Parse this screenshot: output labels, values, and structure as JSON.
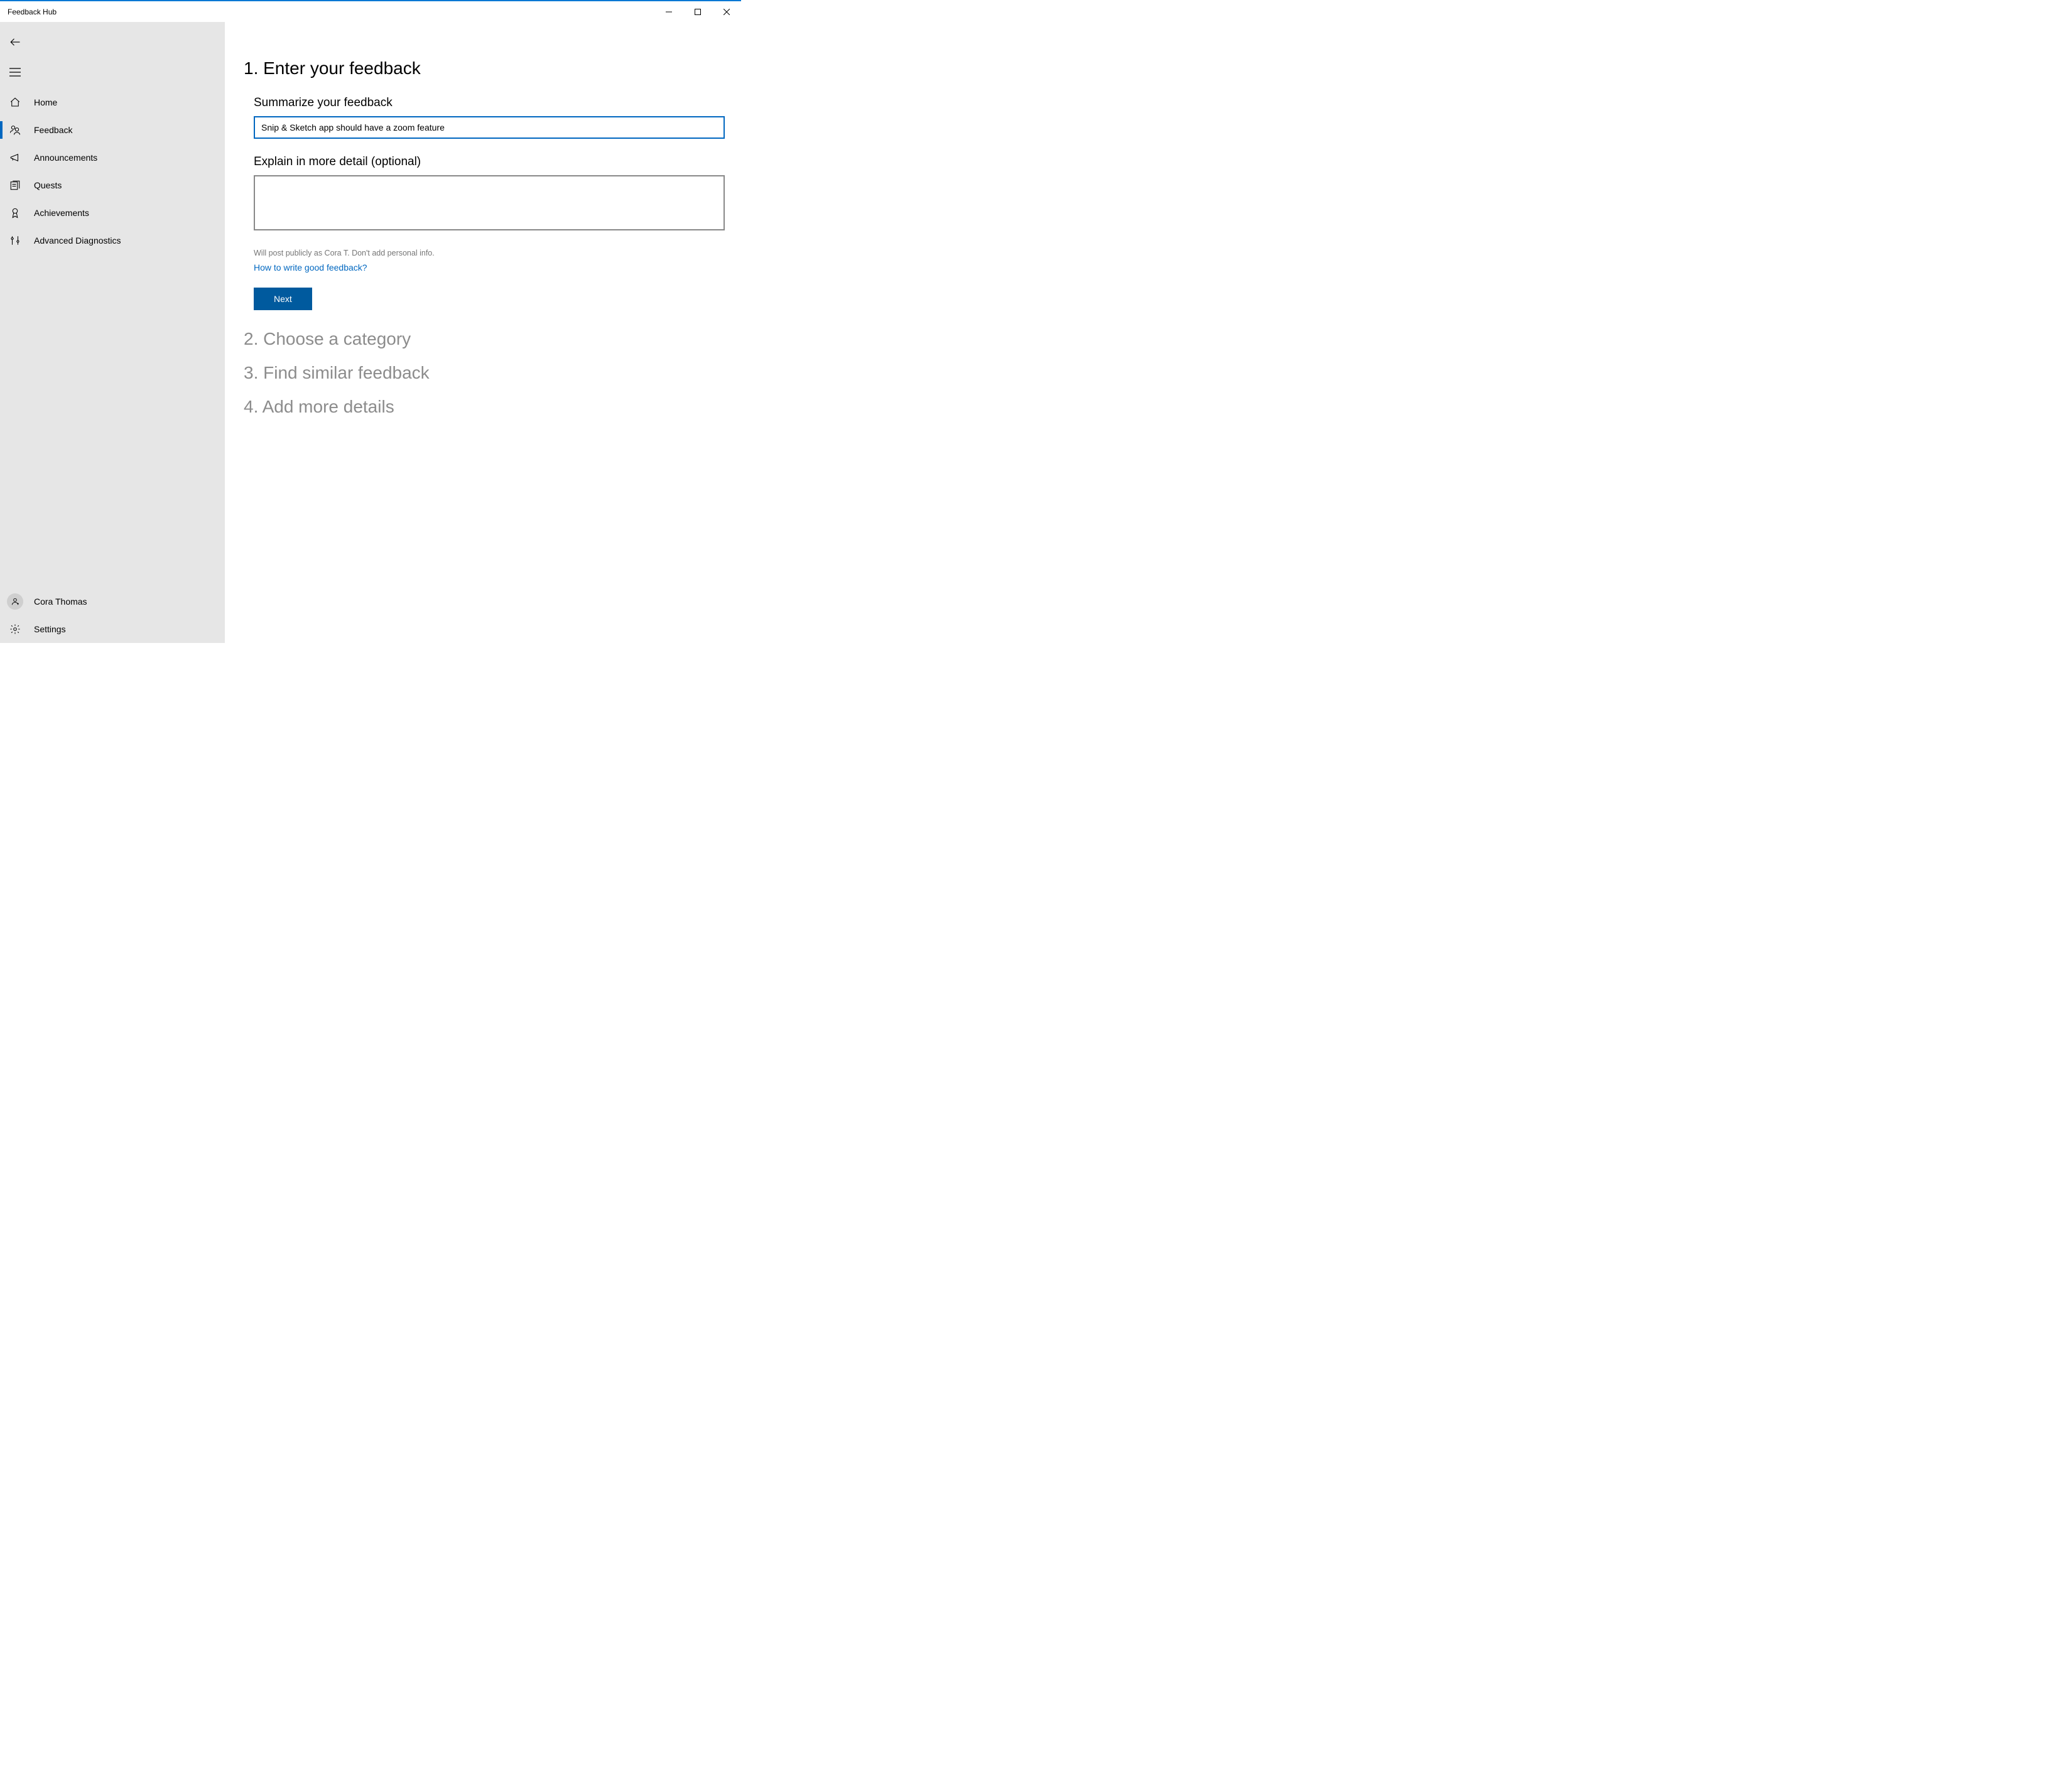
{
  "window": {
    "title": "Feedback Hub"
  },
  "sidebar": {
    "nav": [
      {
        "id": "home",
        "label": "Home"
      },
      {
        "id": "feedback",
        "label": "Feedback"
      },
      {
        "id": "announcements",
        "label": "Announcements"
      },
      {
        "id": "quests",
        "label": "Quests"
      },
      {
        "id": "achievements",
        "label": "Achievements"
      },
      {
        "id": "advanced-diagnostics",
        "label": "Advanced Diagnostics"
      }
    ],
    "user": {
      "name": "Cora Thomas"
    },
    "settings_label": "Settings"
  },
  "form": {
    "step1_title": "1. Enter your feedback",
    "summary_label": "Summarize your feedback",
    "summary_value": "Snip & Sketch app should have a zoom feature",
    "detail_label": "Explain in more detail (optional)",
    "detail_value": "",
    "post_hint": "Will post publicly as Cora T. Don't add personal info.",
    "help_link": "How to write good feedback?",
    "next_label": "Next",
    "step2_title": "2. Choose a category",
    "step3_title": "3. Find similar feedback",
    "step4_title": "4. Add more details"
  },
  "colors": {
    "accent": "#0067c0",
    "sidebar_bg": "#e6e6e6",
    "disabled_text": "#8c8c8c"
  }
}
